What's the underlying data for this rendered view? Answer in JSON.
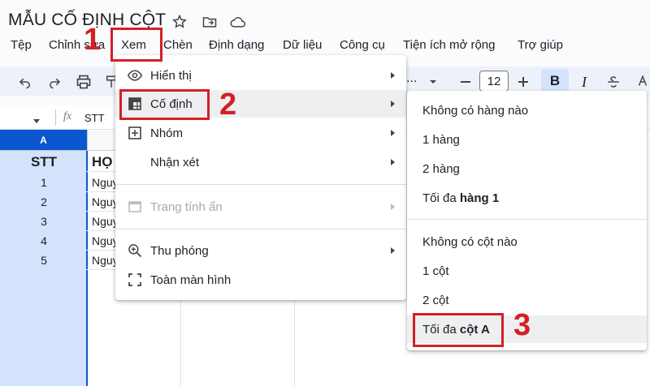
{
  "title": "MẪU CỐ ĐỊNH CỘT",
  "menubar": [
    "Tệp",
    "Chỉnh sửa",
    "Xem",
    "Chèn",
    "Định dạng",
    "Dữ liệu",
    "Công cụ",
    "Tiện ích mở rộng",
    "Trợ giúp"
  ],
  "toolbar": {
    "font_size": "12",
    "zoom_partial": "..."
  },
  "formula_bar": {
    "cell_ref": "",
    "fx": "fx",
    "content": "STT"
  },
  "sheet": {
    "col_a_header": "A",
    "rows": [
      {
        "stt": "STT",
        "b": "HỌ"
      },
      {
        "stt": "1",
        "b": "Nguy"
      },
      {
        "stt": "2",
        "b": "Nguy"
      },
      {
        "stt": "3",
        "b": "Nguy"
      },
      {
        "stt": "4",
        "b": "Nguy"
      },
      {
        "stt": "5",
        "b": "Nguy"
      }
    ]
  },
  "view_menu": {
    "show": "Hiển thị",
    "freeze": "Cố định",
    "group": "Nhóm",
    "comments": "Nhận xét",
    "hidden_sheets": "Trang tính ẩn",
    "zoom": "Thu phóng",
    "fullscreen": "Toàn màn hình"
  },
  "freeze_submenu": {
    "no_rows": "Không có hàng nào",
    "one_row": "1 hàng",
    "two_rows": "2 hàng",
    "upto_row_prefix": "Tối đa ",
    "upto_row_bold": "hàng 1",
    "no_cols": "Không có cột nào",
    "one_col": "1 cột",
    "two_cols": "2 cột",
    "upto_col_prefix": "Tối đa ",
    "upto_col_bold": "cột A"
  },
  "steps": [
    "1",
    "2",
    "3"
  ],
  "colors": {
    "accent": "#0b57d0",
    "annotation": "#d32027",
    "highlight": "#edeff1"
  }
}
